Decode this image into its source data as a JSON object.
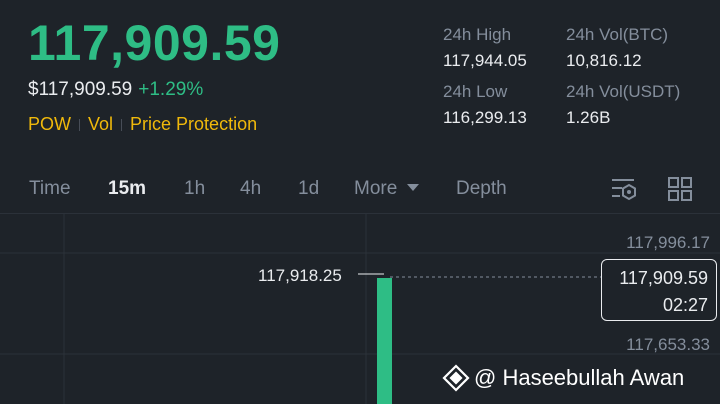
{
  "ticker": {
    "last_price": "117,909.59",
    "usd_price": "$117,909.59",
    "change_pct": "+1.29%",
    "tags": [
      "POW",
      "Vol",
      "Price Protection"
    ]
  },
  "stats": {
    "high_label": "24h High",
    "high_value": "117,944.05",
    "low_label": "24h Low",
    "low_value": "116,299.13",
    "vol_btc_label": "24h Vol(BTC)",
    "vol_btc_value": "10,816.12",
    "vol_usdt_label": "24h Vol(USDT)",
    "vol_usdt_value": "1.26B"
  },
  "tabs": {
    "time": "Time",
    "m15": "15m",
    "h1": "1h",
    "h4": "4h",
    "d1": "1d",
    "more": "More",
    "depth": "Depth"
  },
  "icons": {
    "settings": "chart-settings-icon",
    "grid": "layout-grid-icon",
    "watermark_logo": "binance-diamond-icon"
  },
  "chart": {
    "axis_top": "117,996.17",
    "axis_mid": "117,653.33",
    "high_marker": "117,918.25",
    "current_price": "117,909.59",
    "countdown": "02:27"
  },
  "watermark": {
    "text": "@ Haseebullah Awan"
  },
  "colors": {
    "up": "#2ebd85",
    "accent": "#f0b90b",
    "background": "#1e2329",
    "muted": "#848e9c"
  }
}
